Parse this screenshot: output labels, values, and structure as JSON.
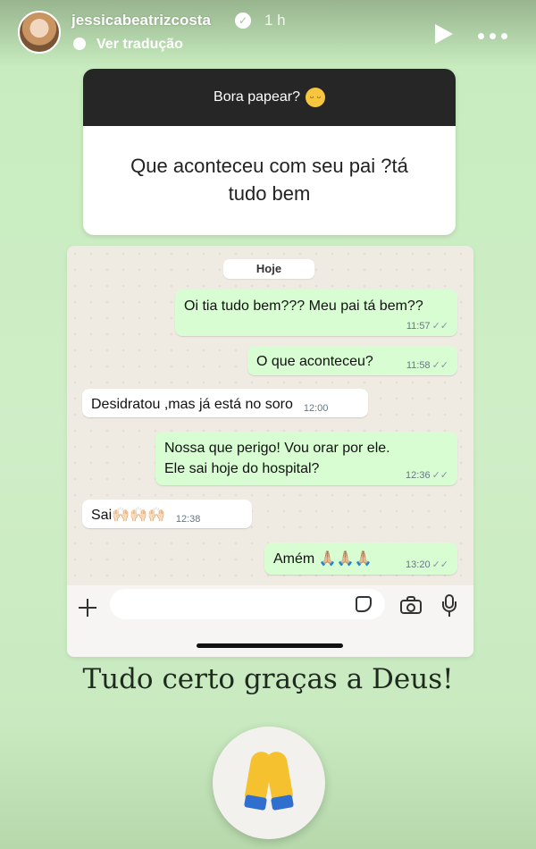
{
  "header": {
    "username": "jessicabeatrizcosta",
    "verified_icon": "verified-badge-icon",
    "time_ago": "1 h",
    "translate_label": "Ver tradução",
    "icons": [
      "translate-icon",
      "play-icon",
      "more-icon"
    ]
  },
  "question_sticker": {
    "prompt": "Bora papear?",
    "prompt_emoji": "relieved-face-icon",
    "answer": "Que aconteceu com seu pai ?tá tudo bem"
  },
  "chat": {
    "date_label": "Hoje",
    "messages": [
      {
        "direction": "out",
        "text": "Oi tia tudo bem??? Meu pai tá bem??",
        "time": "11:57",
        "ticks": "✓✓"
      },
      {
        "direction": "out",
        "text": "O que aconteceu?",
        "time": "11:58",
        "ticks": "✓✓"
      },
      {
        "direction": "in",
        "text": "Desidratou ,mas já está no soro",
        "time": "12:00"
      },
      {
        "direction": "out",
        "text": "Nossa que perigo! Vou orar por ele. Ele sai hoje do hospital?",
        "time": "12:36",
        "ticks": "✓✓"
      },
      {
        "direction": "in",
        "text": "Sai🙌🏻🙌🏻🙌🏻",
        "time": "12:38"
      },
      {
        "direction": "out",
        "text": "Amém 🙏🏼🙏🏼🙏🏼",
        "time": "13:20",
        "ticks": "✓✓"
      }
    ],
    "composer": {
      "input_value": "",
      "icons": [
        "plus-icon",
        "sticker-icon",
        "camera-icon",
        "mic-icon"
      ]
    }
  },
  "caption": "Tudo certo graças a Deus!",
  "reaction": {
    "icon": "folded-hands-icon"
  },
  "colors": {
    "background": "#cfeec7",
    "outgoing_bubble": "#d9fdd3",
    "incoming_bubble": "#ffffff",
    "chat_background": "#efeae2",
    "question_header": "#262626"
  }
}
